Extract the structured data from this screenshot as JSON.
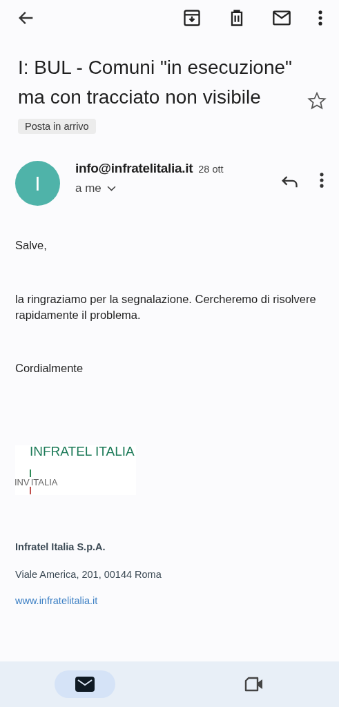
{
  "subject": "I: BUL - Comuni \"in esecuzione\" ma con tracciato non visibile",
  "label": "Posta in arrivo",
  "starred": false,
  "sender": {
    "initial": "I",
    "address": "info@infratelitalia.it",
    "date": "28 ott",
    "recipient": "a me"
  },
  "body": [
    "Salve,",
    "la ringraziamo per la segnalazione. Cercheremo di risolvere rapidamente il problema.",
    "Cordialmente"
  ],
  "logo": {
    "title": "INFRATEL ITALIA",
    "subtitle_left": "INV",
    "subtitle_right": "ITALIA"
  },
  "signature": {
    "company": "Infratel Italia S.p.A.",
    "address": "Viale America, 201, 00144 Roma",
    "website": "www.infratelitalia.it"
  },
  "nav": [
    {
      "kind": "mail",
      "selected": true
    },
    {
      "kind": "video",
      "selected": false
    }
  ]
}
